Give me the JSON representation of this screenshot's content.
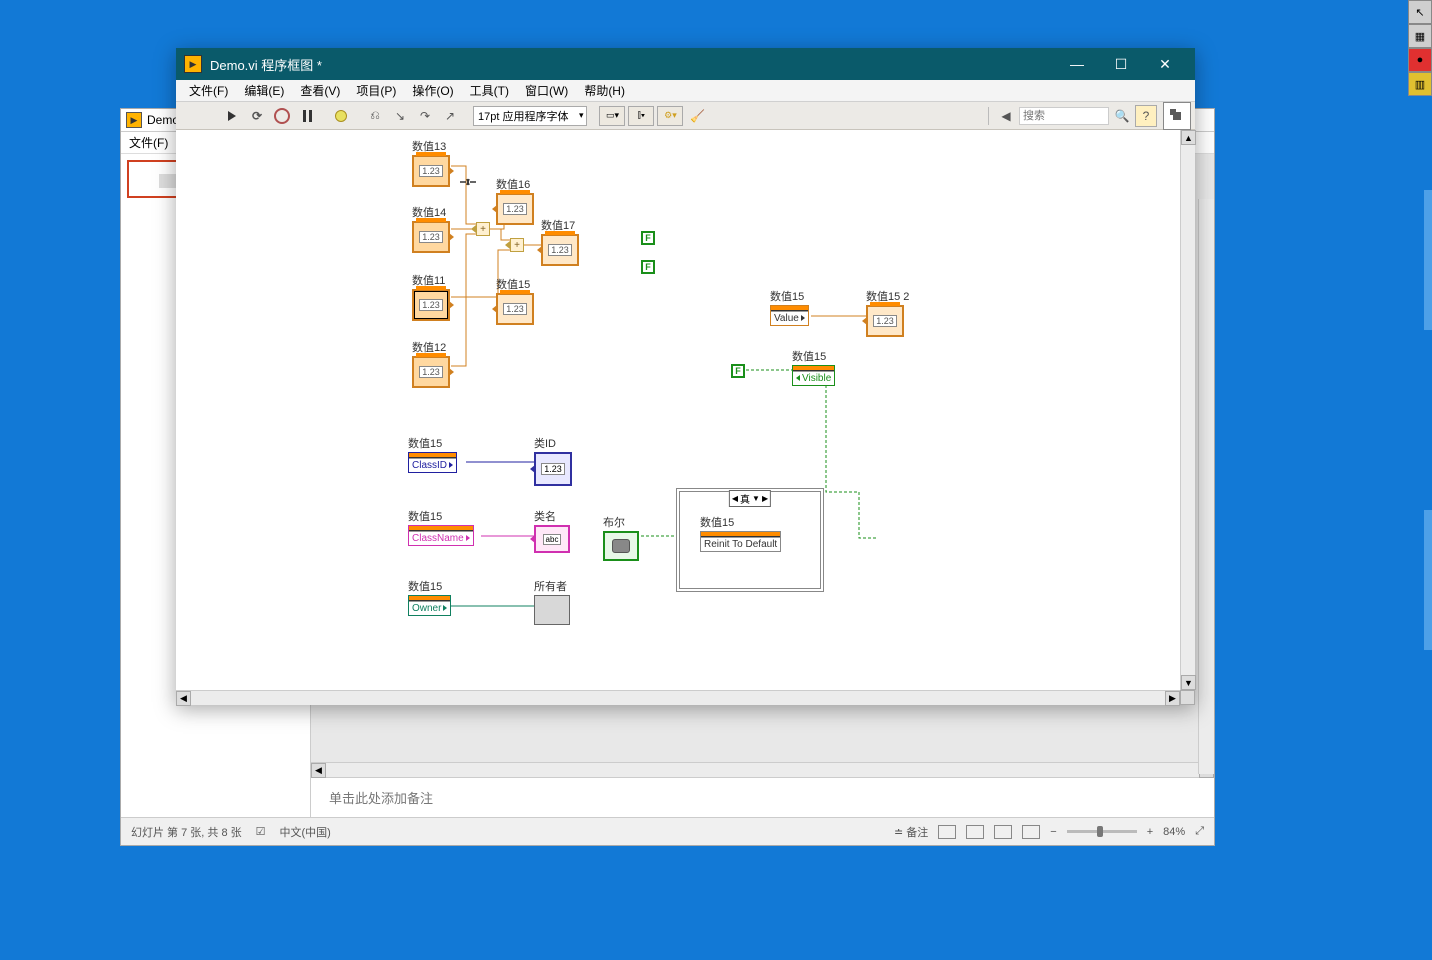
{
  "edge_tools": [
    "↖",
    "▦",
    "●",
    "▥"
  ],
  "ppt": {
    "title": "Demo...",
    "menu_file": "文件(F)",
    "notes_placeholder": "单击此处添加备注",
    "status_slide": "幻灯片 第 7 张, 共 8 张",
    "status_lang": "中文(中国)",
    "status_notes": "备注",
    "zoom_pct": "84%"
  },
  "lv": {
    "title": "Demo.vi 程序框图 *",
    "menu": [
      "文件(F)",
      "编辑(E)",
      "查看(V)",
      "项目(P)",
      "操作(O)",
      "工具(T)",
      "窗口(W)",
      "帮助(H)"
    ],
    "font_sel": "17pt 应用程序字体",
    "search_placeholder": "搜索"
  },
  "nodes": {
    "n13": "数值13",
    "n14": "数值14",
    "n11": "数值11",
    "n12": "数值12",
    "n16": "数值16",
    "n17": "数值17",
    "n15": "数值15",
    "n15_ref_a": "数值15",
    "n15_2": "数值15 2",
    "n15_vis": "数值15",
    "n15_cid": "数值15",
    "classid": "类ID",
    "n15_cn": "数值15",
    "classname": "类名",
    "n15_ow": "数值15",
    "owner": "所有者",
    "bool": "布尔",
    "case_true": "真",
    "n15_case": "数值15",
    "value_txt": "Value",
    "visible_txt": "Visible",
    "classid_txt": "ClassID",
    "classname_txt": "ClassName",
    "owner_txt": "Owner",
    "reinit_txt": "Reinit To Default",
    "num_glyph": "1.23",
    "abc_glyph": "abc",
    "bool_f": "F"
  }
}
